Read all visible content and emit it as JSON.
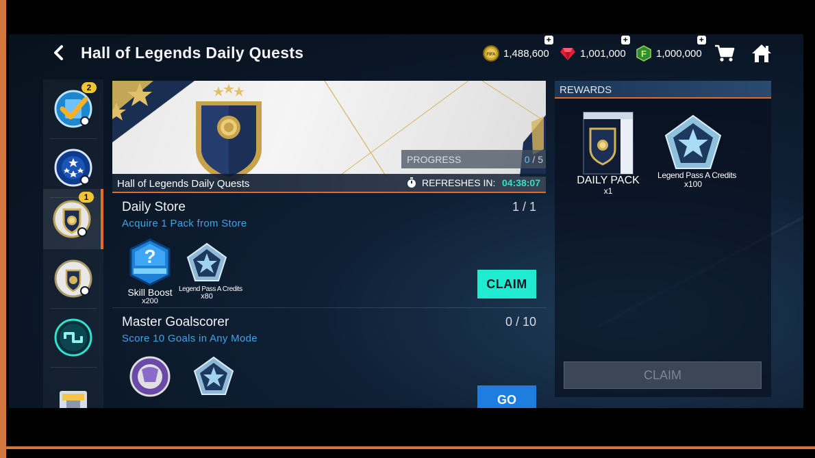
{
  "header": {
    "back_icon": "chevron-left-icon",
    "title": "Hall of Legends Daily Quests",
    "currencies": [
      {
        "name": "fifa-coins",
        "icon": "fifa-coin-icon",
        "value": "1,488,600",
        "color": "#d4b43a"
      },
      {
        "name": "fifa-points",
        "icon": "ruby-gem-icon",
        "value": "1,001,000",
        "color": "#e0203a"
      },
      {
        "name": "forge-points",
        "icon": "f-hexagon-icon",
        "value": "1,000,000",
        "color": "#3ea84a"
      }
    ],
    "store_icon": "shopping-cart-icon",
    "home_icon": "home-icon"
  },
  "sidebar": {
    "items": [
      {
        "icon": "quest-checkmark-icon",
        "badge": "2"
      },
      {
        "icon": "champions-ball-icon",
        "badge": ""
      },
      {
        "icon": "hall-of-legends-crest-icon",
        "badge": "1",
        "active": true
      },
      {
        "icon": "silver-crest-icon",
        "badge": ""
      },
      {
        "icon": "chain-link-icon",
        "badge": ""
      },
      {
        "icon": "trophy-card-icon",
        "badge": ""
      }
    ]
  },
  "banner": {
    "title": "Hall of Legends Daily Quests",
    "progress_label": "PROGRESS",
    "progress_done": "0",
    "progress_total": "/ 5",
    "refresh_label": "REFRESHES IN:",
    "refresh_time": "04:38:07"
  },
  "quests": [
    {
      "name": "Daily Store",
      "description": "Acquire 1 Pack from Store",
      "progress": "1 / 1",
      "rewards": [
        {
          "icon": "skill-boost-icon",
          "name": "Skill Boost",
          "qty": "x200"
        },
        {
          "icon": "legend-pass-star-icon",
          "name": "Legend Pass A Credits",
          "qty": "x80"
        }
      ],
      "button": "CLAIM"
    },
    {
      "name": "Master Goalscorer",
      "description": "Score 10 Goals in Any Mode",
      "progress": "0 / 10",
      "rewards": [
        {
          "icon": "ball-boost-icon",
          "name": "",
          "qty": ""
        },
        {
          "icon": "legend-pass-star-icon",
          "name": "",
          "qty": ""
        }
      ],
      "button": "GO"
    }
  ],
  "rewards_panel": {
    "header": "REWARDS",
    "items": [
      {
        "icon": "daily-pack-icon",
        "name": "DAILY PACK",
        "qty": "x1"
      },
      {
        "icon": "legend-pass-star-icon",
        "name": "Legend Pass A Credits",
        "qty": "x100"
      }
    ],
    "claim_label": "CLAIM"
  },
  "colors": {
    "accent_orange": "#e46b2a",
    "claim_teal": "#20ead0",
    "quest_desc_blue": "#39a7e8"
  }
}
